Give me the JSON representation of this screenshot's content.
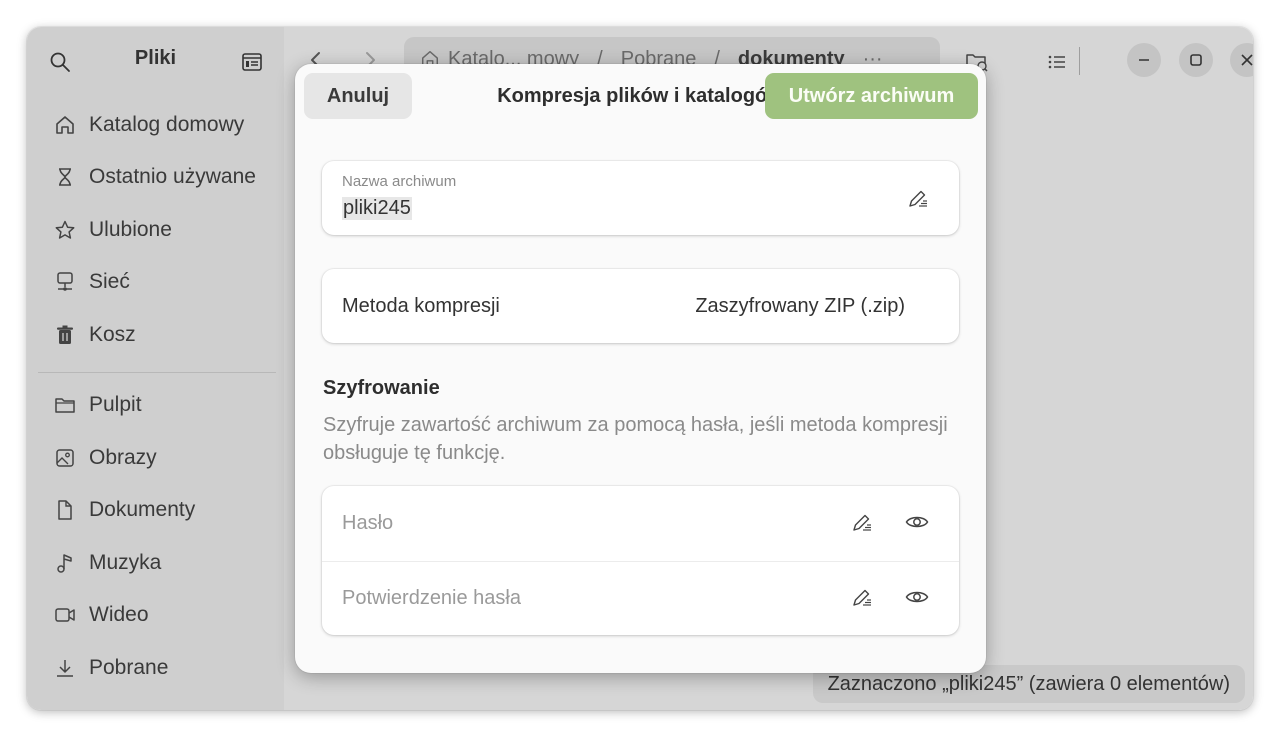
{
  "sidebar": {
    "title": "Pliki",
    "places": [
      {
        "label": "Katalog domowy",
        "icon": "home-icon"
      },
      {
        "label": "Ostatnio używane",
        "icon": "hourglass-icon"
      },
      {
        "label": "Ulubione",
        "icon": "star-icon"
      },
      {
        "label": "Sieć",
        "icon": "network-icon"
      },
      {
        "label": "Kosz",
        "icon": "trash-icon"
      }
    ],
    "bookmarks": [
      {
        "label": "Pulpit",
        "icon": "folder-icon"
      },
      {
        "label": "Obrazy",
        "icon": "image-icon"
      },
      {
        "label": "Dokumenty",
        "icon": "document-icon"
      },
      {
        "label": "Muzyka",
        "icon": "music-icon"
      },
      {
        "label": "Wideo",
        "icon": "video-icon"
      },
      {
        "label": "Pobrane",
        "icon": "download-icon"
      }
    ]
  },
  "pathbar": {
    "segments": [
      "Katalo... mowy",
      "/",
      "Pobrane",
      "/"
    ],
    "current": "dokumenty",
    "more": "···"
  },
  "status": {
    "text": "Zaznaczono „pliki245” (zawiera 0 elementów)"
  },
  "dialog": {
    "cancel_label": "Anuluj",
    "title": "Kompresja plików i katalogów",
    "create_label": "Utwórz archiwum",
    "name_label": "Nazwa archiwum",
    "name_value": "pliki245",
    "method_label": "Metoda kompresji",
    "method_value": "Zaszyfrowany ZIP (.zip)",
    "encryption_title": "Szyfrowanie",
    "encryption_desc": "Szyfruje zawartość archiwum za pomocą hasła, jeśli metoda kompresji obsługuje tę funkcję.",
    "password_placeholder": "Hasło",
    "confirm_placeholder": "Potwierdzenie hasła"
  },
  "colors": {
    "accent": "#9fc27f",
    "sidebar_bg": "#cfcfcf",
    "main_bg": "#d6d6d6",
    "dialog_bg": "#fafafa"
  }
}
